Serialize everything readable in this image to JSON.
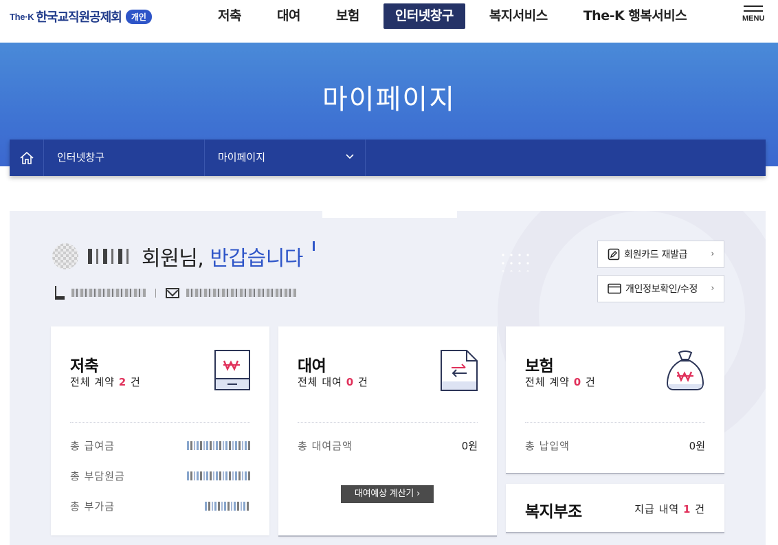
{
  "header": {
    "logo": {
      "brand": "The·K",
      "name": "한국교직원공제회",
      "badge": "개인"
    },
    "nav": [
      {
        "label": "저축",
        "active": false
      },
      {
        "label": "대여",
        "active": false
      },
      {
        "label": "보험",
        "active": false
      },
      {
        "label": "인터넷창구",
        "active": true
      },
      {
        "label": "복지서비스",
        "active": false
      },
      {
        "label": "The-K 행복서비스",
        "active": false
      }
    ],
    "menu_label": "MENU"
  },
  "hero": {
    "title": "마이페이지"
  },
  "breadcrumb": {
    "home_icon": "home-icon",
    "items": [
      {
        "label": "인터넷창구"
      },
      {
        "label": "마이페이지",
        "has_dropdown": true
      }
    ]
  },
  "profile": {
    "greeting_suffix": "회원님,",
    "greeting_highlight": "반갑습니다",
    "phone_icon": "phone-icon",
    "mail_icon": "mail-icon",
    "buttons": [
      {
        "label": "회원카드 재발급",
        "icon": "edit-icon"
      },
      {
        "label": "개인정보확인/수정",
        "icon": "card-icon"
      }
    ]
  },
  "cards": {
    "savings": {
      "title": "저축",
      "sub_prefix": "전체 계약",
      "count": "2",
      "sub_suffix": "건",
      "icon": "won-bill-icon",
      "rows": [
        {
          "label": "총 급여금"
        },
        {
          "label": "총 부담원금"
        },
        {
          "label": "총 부가금"
        }
      ]
    },
    "loan": {
      "title": "대여",
      "sub_prefix": "전체 대여",
      "count": "0",
      "sub_suffix": "건",
      "icon": "document-exchange-icon",
      "rows": [
        {
          "label": "총 대여금액",
          "value": "0원"
        }
      ],
      "calc_button": "대여예상 계산기 ›"
    },
    "insurance": {
      "title": "보험",
      "sub_prefix": "전체 계약",
      "count": "0",
      "sub_suffix": "건",
      "icon": "money-bag-icon",
      "rows": [
        {
          "label": "총 납입액",
          "value": "0원"
        }
      ]
    },
    "welfare": {
      "title": "복지부조",
      "sub_prefix": "지급 내역",
      "count": "1",
      "sub_suffix": "건"
    }
  },
  "colors": {
    "navy": "#233f99",
    "accent_blue": "#2e55c8",
    "count_red": "#e0305a",
    "active_nav": "#253367"
  }
}
